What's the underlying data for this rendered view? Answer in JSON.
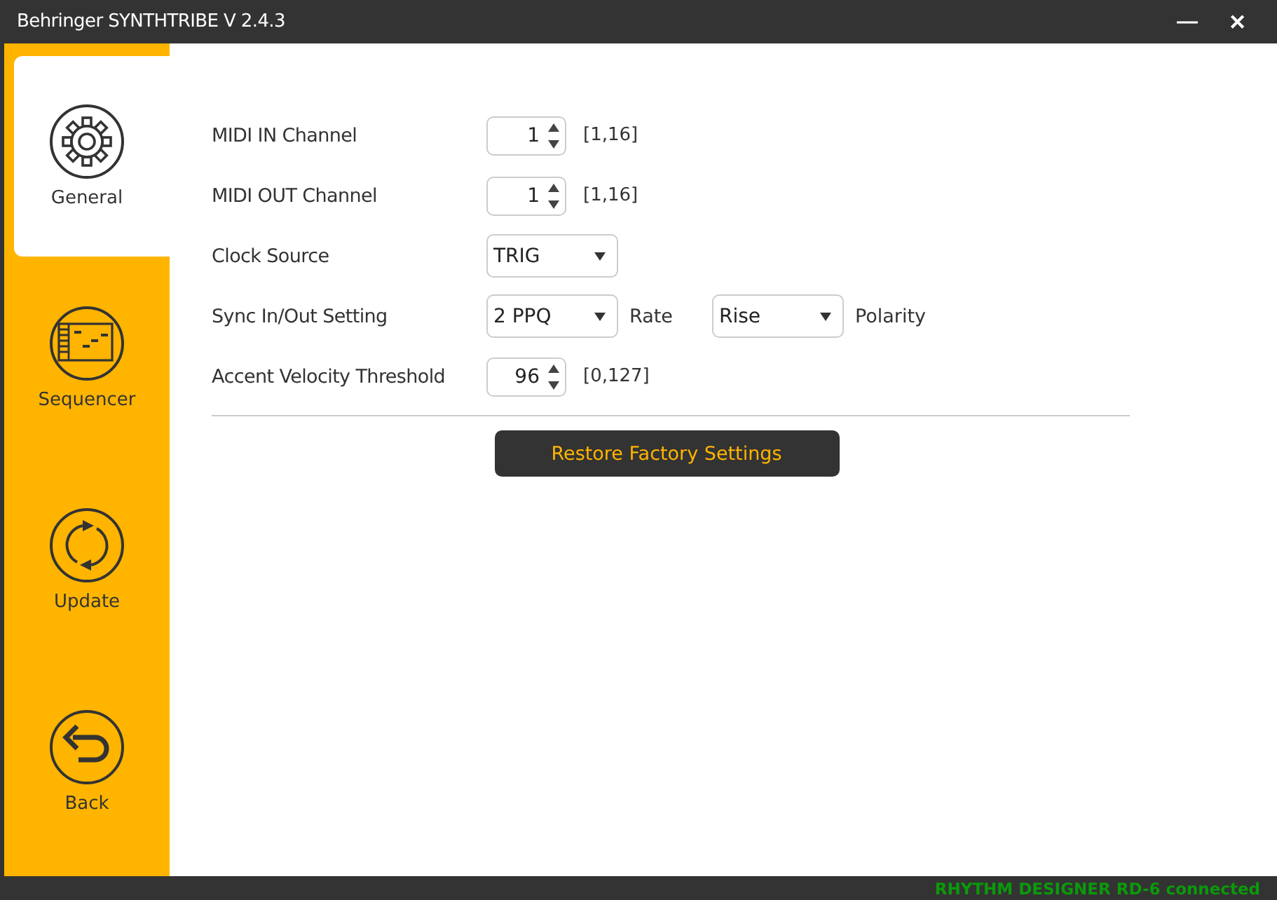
{
  "window": {
    "title": "Behringer SYNTHTRIBE V 2.4.3",
    "controls": [
      "—",
      "✕"
    ]
  },
  "sidebar": {
    "items": [
      {
        "label": "General",
        "kind": "gear",
        "selected": true
      },
      {
        "label": "Sequencer",
        "kind": "sequencer",
        "selected": false
      },
      {
        "label": "Update",
        "kind": "update",
        "selected": false
      },
      {
        "label": "Back",
        "kind": "back",
        "selected": false
      }
    ]
  },
  "settings": [
    {
      "kind": "spinbox",
      "label": "MIDI IN Channel",
      "value": "1",
      "range": "[1,16]"
    },
    {
      "kind": "spinbox",
      "label": "MIDI OUT Channel",
      "value": "1",
      "range": "[1,16]"
    },
    {
      "kind": "dropdown",
      "label": "Clock Source",
      "value": "TRIG"
    },
    {
      "kind": "sync",
      "label": "Sync In/Out Setting",
      "value": "2 PPQ",
      "value_label": "Rate",
      "second_value": "Rise",
      "second_label": "Polarity"
    },
    {
      "kind": "spinbox",
      "label": "Accent Velocity Threshold",
      "value": "96",
      "range": "[0,127]"
    }
  ],
  "restore_button": "Restore Factory Settings",
  "status_bar": "RHYTHM DESIGNER RD-6 connected"
}
